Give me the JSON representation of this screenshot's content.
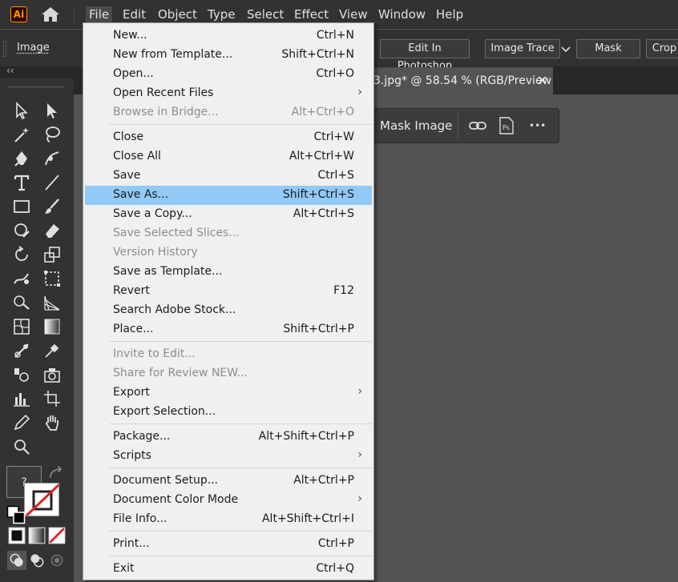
{
  "app": {
    "logo_text": "Ai"
  },
  "menubar": {
    "items": [
      "File",
      "Edit",
      "Object",
      "Type",
      "Select",
      "Effect",
      "View",
      "Window",
      "Help"
    ]
  },
  "control_bar": {
    "label": "Image",
    "buttons": {
      "edit_in_photoshop": "Edit In Photoshop",
      "image_trace": "Image Trace",
      "mask": "Mask",
      "crop": "Crop"
    }
  },
  "document": {
    "tab_title": "3.jpg* @ 58.54 % (RGB/Preview",
    "close_glyph": "✕"
  },
  "quick_actions": {
    "mask_image": "Mask Image",
    "ps_badge": "Ps",
    "more_glyph": "•••"
  },
  "swatch": {
    "unknown_glyph": "?"
  },
  "file_menu": {
    "groups": [
      [
        {
          "label": "New...",
          "shortcut": "Ctrl+N"
        },
        {
          "label": "New from Template...",
          "shortcut": "Shift+Ctrl+N"
        },
        {
          "label": "Open...",
          "shortcut": "Ctrl+O"
        },
        {
          "label": "Open Recent Files",
          "submenu": "›"
        },
        {
          "label": "Browse in Bridge...",
          "shortcut": "Alt+Ctrl+O",
          "disabled": true
        }
      ],
      [
        {
          "label": "Close",
          "shortcut": "Ctrl+W"
        },
        {
          "label": "Close All",
          "shortcut": "Alt+Ctrl+W"
        },
        {
          "label": "Save",
          "shortcut": "Ctrl+S"
        },
        {
          "label": "Save As...",
          "shortcut": "Shift+Ctrl+S",
          "highlight": true
        },
        {
          "label": "Save a Copy...",
          "shortcut": "Alt+Ctrl+S"
        },
        {
          "label": "Save Selected Slices...",
          "disabled": true
        },
        {
          "label": "Version History",
          "disabled": true
        },
        {
          "label": "Save as Template..."
        },
        {
          "label": "Revert",
          "shortcut": "F12"
        },
        {
          "label": "Search Adobe Stock..."
        },
        {
          "label": "Place...",
          "shortcut": "Shift+Ctrl+P"
        }
      ],
      [
        {
          "label": "Invite to Edit...",
          "disabled": true
        },
        {
          "label": "Share for Review NEW...",
          "disabled": true
        },
        {
          "label": "Export",
          "submenu": "›"
        },
        {
          "label": "Export Selection..."
        }
      ],
      [
        {
          "label": "Package...",
          "shortcut": "Alt+Shift+Ctrl+P"
        },
        {
          "label": "Scripts",
          "submenu": "›"
        }
      ],
      [
        {
          "label": "Document Setup...",
          "shortcut": "Alt+Ctrl+P"
        },
        {
          "label": "Document Color Mode",
          "submenu": "›"
        },
        {
          "label": "File Info...",
          "shortcut": "Alt+Shift+Ctrl+I"
        }
      ],
      [
        {
          "label": "Print...",
          "shortcut": "Ctrl+P"
        }
      ],
      [
        {
          "label": "Exit",
          "shortcut": "Ctrl+Q"
        }
      ]
    ]
  },
  "colors": {
    "menu_highlight": "#91c9f7",
    "menu_background": "#f0f0f0",
    "chrome_dark": "#323232",
    "canvas": "#535353",
    "ai_orange": "#ff9a00"
  }
}
